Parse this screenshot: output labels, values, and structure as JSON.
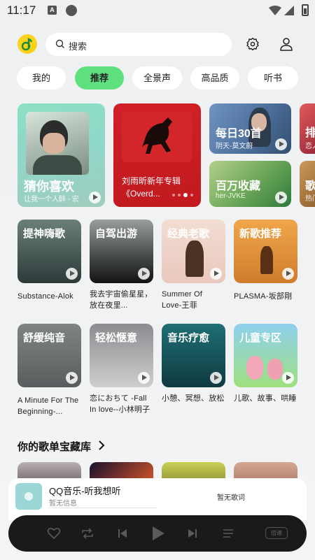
{
  "status_bar": {
    "time": "11:17"
  },
  "search": {
    "placeholder": "搜索"
  },
  "tabs": [
    {
      "label": "我的",
      "active": false
    },
    {
      "label": "推荐",
      "active": true
    },
    {
      "label": "全景声",
      "active": false
    },
    {
      "label": "高品质",
      "active": false
    },
    {
      "label": "听书",
      "active": false
    }
  ],
  "featured": {
    "guess": {
      "title": "猜你喜欢",
      "subtitle": "让我一个人醉 - 宏"
    },
    "album": {
      "line1": "刘雨昕新年专辑",
      "line2": "《Overd..."
    },
    "daily": {
      "title": "每日30首",
      "subtitle": "阴天-莫文蔚"
    },
    "million": {
      "title": "百万收藏",
      "subtitle": "her-JVKE"
    },
    "rank": {
      "title": "排",
      "subtitle": "恋人"
    },
    "song": {
      "title": "歌",
      "subtitle": "热门"
    }
  },
  "grid_row1": [
    {
      "title": "提神嗨歌",
      "caption": "Substance-Alok"
    },
    {
      "title": "自驾出游",
      "caption": "我去宇宙偷星星，放在夜里..."
    },
    {
      "title": "经典老歌",
      "caption": "Summer Of Love-王菲"
    },
    {
      "title": "新歌推荐",
      "caption": "PLASMA-坂部剛"
    }
  ],
  "grid_row2": [
    {
      "title": "舒缓纯音",
      "caption": "A Minute For The Beginning-..."
    },
    {
      "title": "轻松惬意",
      "caption": "恋におちて -Fall In love--小林明子"
    },
    {
      "title": "音乐疗愈",
      "caption": "小憩、冥想、放松"
    },
    {
      "title": "儿童专区",
      "caption": "儿歌、故事、哄睡"
    }
  ],
  "section": {
    "title": "你的歌单宝藏库"
  },
  "player": {
    "title": "QQ音乐-听我想听",
    "subtitle": "暂无信息",
    "lyric": "暂无歌词",
    "speed": "倍速"
  },
  "colors": {
    "accent": "#5fe07f",
    "brand_yellow": "#fcd21b"
  }
}
